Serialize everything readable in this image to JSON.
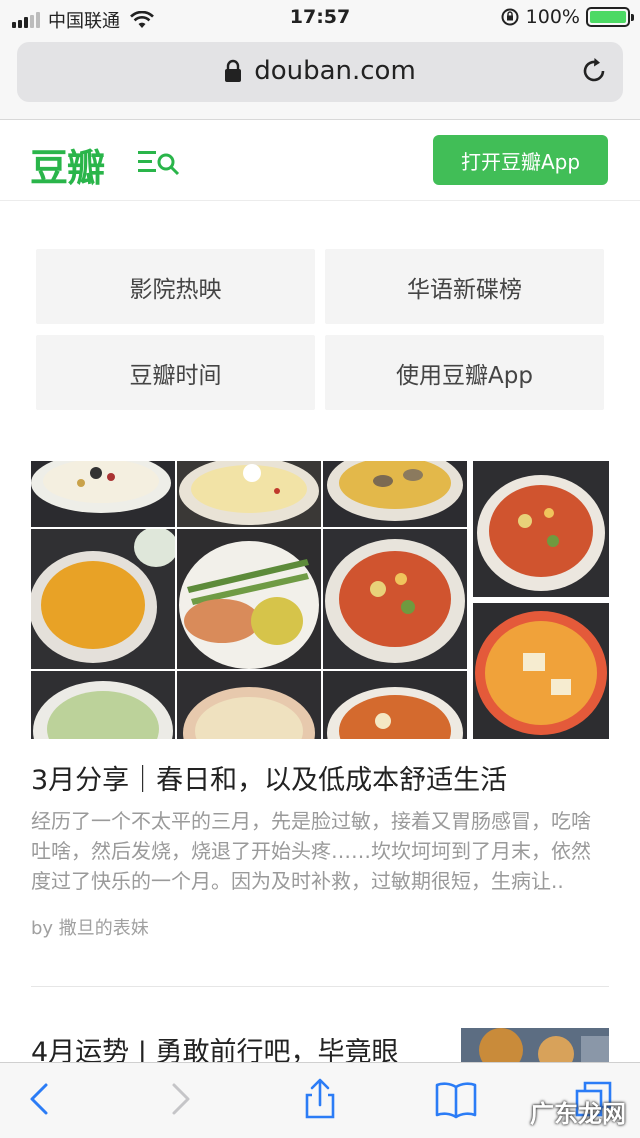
{
  "status_bar": {
    "carrier": "中国联通",
    "time": "17:57",
    "battery": "100%",
    "battery_level": 1.0,
    "signal_bars_filled": 3,
    "signal_bars_total": 5
  },
  "browser": {
    "url": "douban.com"
  },
  "header": {
    "logo": "豆瓣",
    "open_app": "打开豆瓣App",
    "brand_color": "#41be57"
  },
  "nav": {
    "items": [
      {
        "label": "影院热映"
      },
      {
        "label": "华语新碟榜"
      },
      {
        "label": "豆瓣时间"
      },
      {
        "label": "使用豆瓣App"
      }
    ]
  },
  "articles": [
    {
      "title": "3月分享｜春日和，以及低成本舒适生活",
      "excerpt_lines": [
        "经历了一个不太平的三月，先是脸过敏，接着又胃肠感冒，吃啥",
        "吐啥，然后发烧，烧退了开始头疼……坎坎坷坷到了月末，依然",
        "度过了快乐的一个月。因为及时补救，过敏期很短，生病让.."
      ],
      "author": "by 撒旦的表妹"
    },
    {
      "title": "4月运势 | 勇敢前行吧，毕竟眼"
    }
  ],
  "toolbar": {
    "icons": [
      "back-arrow-icon",
      "forward-arrow-icon",
      "share-icon",
      "bookmarks-icon",
      "tabs-icon"
    ]
  },
  "watermark": "广东龙网"
}
